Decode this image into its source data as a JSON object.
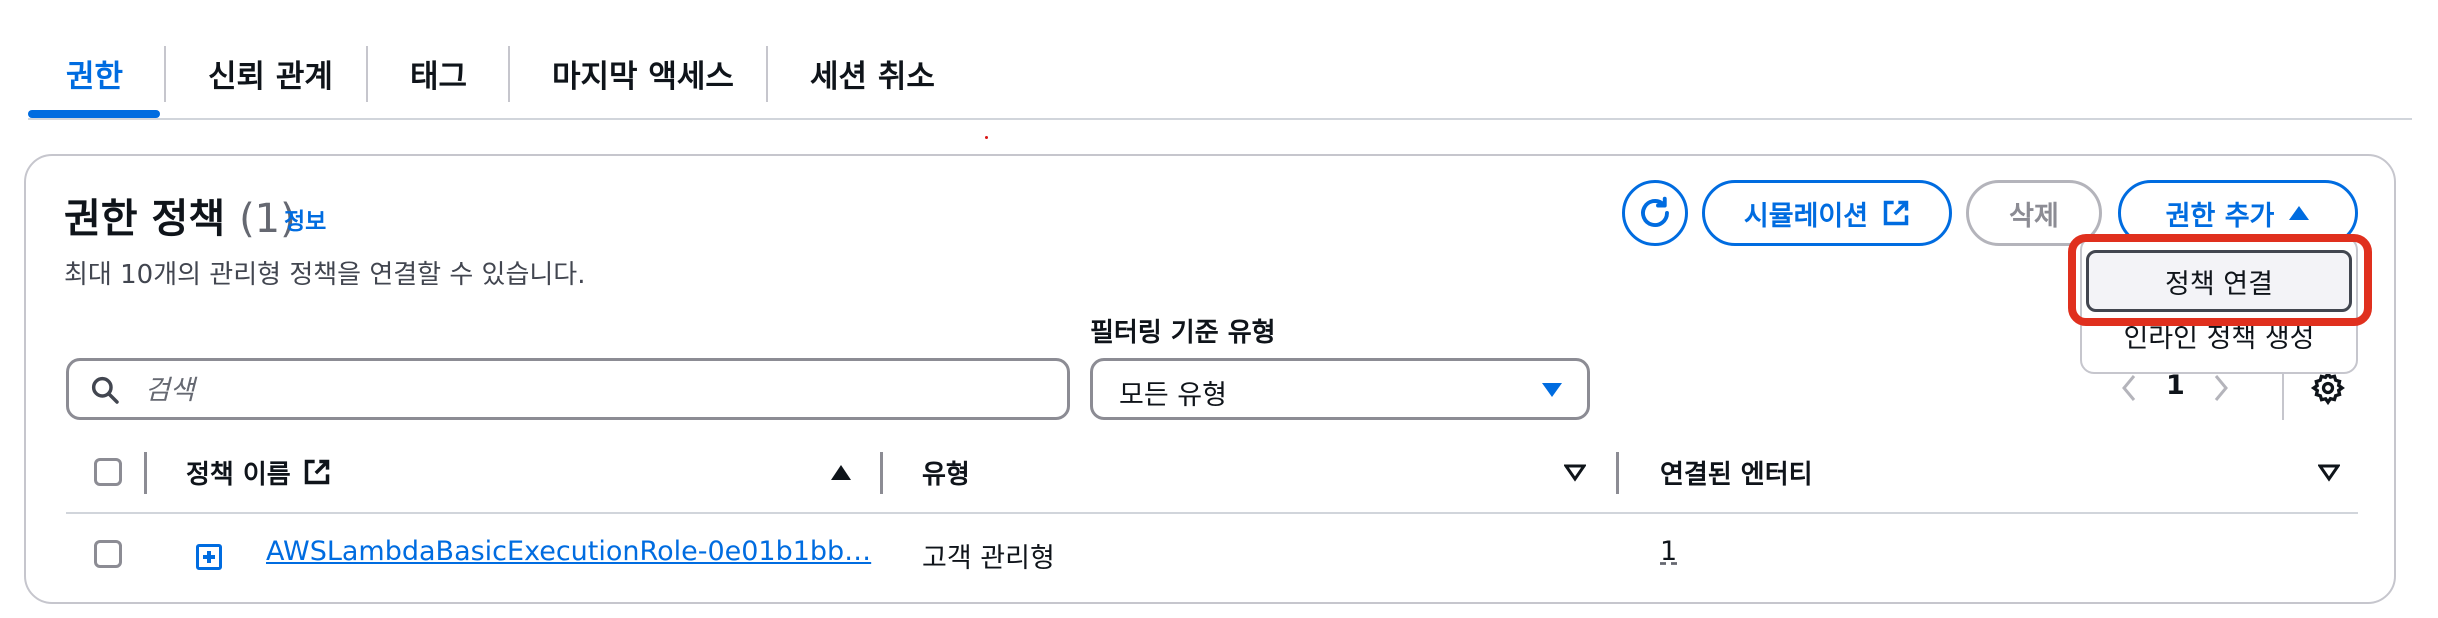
{
  "tabs": [
    {
      "label": "권한",
      "active": true
    },
    {
      "label": "신뢰 관계"
    },
    {
      "label": "태그"
    },
    {
      "label": "마지막 액세스"
    },
    {
      "label": "세션 취소"
    }
  ],
  "section": {
    "title": "권한 정책",
    "count": "(1)",
    "info": "정보",
    "description": "최대 10개의 관리형 정책을 연결할 수 있습니다."
  },
  "actions": {
    "simulate_label": "시뮬레이션",
    "delete_label": "삭제",
    "add_permissions_label": "권한 추가"
  },
  "dropdown": {
    "items": [
      "정책 연결",
      "인라인 정책 생성"
    ]
  },
  "search": {
    "placeholder": "검색",
    "value": ""
  },
  "filter": {
    "label": "필터링 기준 유형",
    "selected": "모든 유형"
  },
  "pagination": {
    "current_page": "1"
  },
  "table": {
    "columns": [
      "정책 이름",
      "유형",
      "연결된 엔터티"
    ],
    "rows": [
      {
        "name": "AWSLambdaBasicExecutionRole-0e01b1bb…",
        "type": "고객 관리형",
        "attached_entities": "1"
      }
    ]
  },
  "colors": {
    "accent": "#006ce0",
    "highlight": "#e0301e",
    "border": "#c6c6cd"
  }
}
